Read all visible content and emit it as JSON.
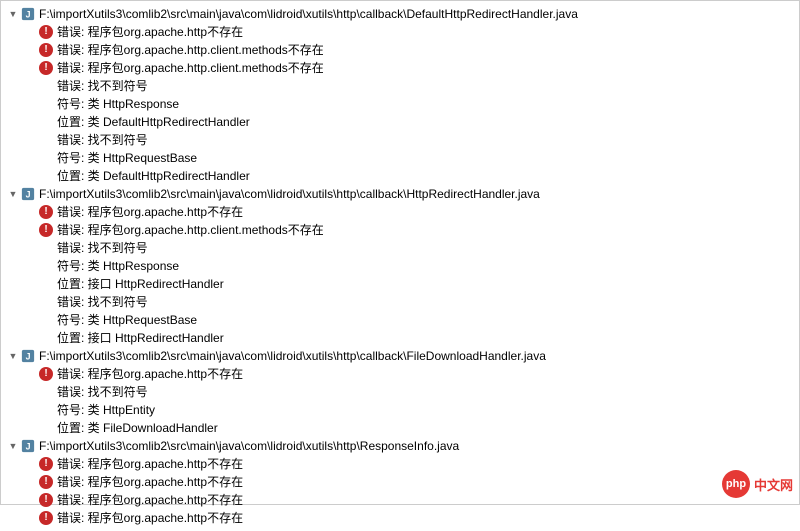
{
  "files": [
    {
      "path": "F:\\importXutils3\\comlib2\\src\\main\\java\\com\\lidroid\\xutils\\http\\callback\\DefaultHttpRedirectHandler.java",
      "errors": [
        {
          "icon": true,
          "text": "错误: 程序包org.apache.http不存在"
        },
        {
          "icon": true,
          "text": "错误: 程序包org.apache.http.client.methods不存在"
        },
        {
          "icon": true,
          "text": "错误: 程序包org.apache.http.client.methods不存在"
        },
        {
          "icon": false,
          "text": "错误: 找不到符号"
        },
        {
          "icon": false,
          "text": "符号:   类 HttpResponse"
        },
        {
          "icon": false,
          "text": "位置: 类 DefaultHttpRedirectHandler"
        },
        {
          "icon": false,
          "text": "错误: 找不到符号"
        },
        {
          "icon": false,
          "text": "符号:   类 HttpRequestBase"
        },
        {
          "icon": false,
          "text": "位置: 类 DefaultHttpRedirectHandler"
        }
      ]
    },
    {
      "path": "F:\\importXutils3\\comlib2\\src\\main\\java\\com\\lidroid\\xutils\\http\\callback\\HttpRedirectHandler.java",
      "errors": [
        {
          "icon": true,
          "text": "错误: 程序包org.apache.http不存在"
        },
        {
          "icon": true,
          "text": "错误: 程序包org.apache.http.client.methods不存在"
        },
        {
          "icon": false,
          "text": "错误: 找不到符号"
        },
        {
          "icon": false,
          "text": "符号:   类 HttpResponse"
        },
        {
          "icon": false,
          "text": "位置: 接口 HttpRedirectHandler"
        },
        {
          "icon": false,
          "text": "错误: 找不到符号"
        },
        {
          "icon": false,
          "text": "符号:   类 HttpRequestBase"
        },
        {
          "icon": false,
          "text": "位置: 接口 HttpRedirectHandler"
        }
      ]
    },
    {
      "path": "F:\\importXutils3\\comlib2\\src\\main\\java\\com\\lidroid\\xutils\\http\\callback\\FileDownloadHandler.java",
      "errors": [
        {
          "icon": true,
          "text": "错误: 程序包org.apache.http不存在"
        },
        {
          "icon": false,
          "text": "错误: 找不到符号"
        },
        {
          "icon": false,
          "text": "符号:   类 HttpEntity"
        },
        {
          "icon": false,
          "text": "位置: 类 FileDownloadHandler"
        }
      ]
    },
    {
      "path": "F:\\importXutils3\\comlib2\\src\\main\\java\\com\\lidroid\\xutils\\http\\ResponseInfo.java",
      "errors": [
        {
          "icon": true,
          "text": "错误: 程序包org.apache.http不存在"
        },
        {
          "icon": true,
          "text": "错误: 程序包org.apache.http不存在"
        },
        {
          "icon": true,
          "text": "错误: 程序包org.apache.http不存在"
        },
        {
          "icon": true,
          "text": "错误: 程序包org.apache.http不存在"
        }
      ]
    }
  ],
  "badge": {
    "short": "php",
    "text": "中文网"
  }
}
